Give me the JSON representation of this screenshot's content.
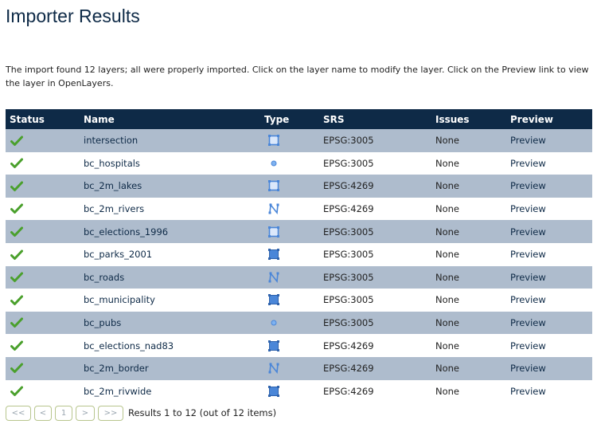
{
  "page": {
    "title": "Importer Results",
    "summary": "The import found 12 layers; all were properly imported. Click on the layer name to modify the layer. Click on the Preview link to view the layer in OpenLayers."
  },
  "table": {
    "headers": {
      "status": "Status",
      "name": "Name",
      "type": "Type",
      "srs": "SRS",
      "issues": "Issues",
      "preview": "Preview"
    },
    "rows": [
      {
        "status": "success-check-icon",
        "name": "intersection",
        "type": "polygon-outline-icon",
        "srs": "EPSG:3005",
        "issues": "None",
        "preview": "Preview"
      },
      {
        "status": "success-check-icon",
        "name": "bc_hospitals",
        "type": "point-icon",
        "srs": "EPSG:3005",
        "issues": "None",
        "preview": "Preview"
      },
      {
        "status": "success-check-icon",
        "name": "bc_2m_lakes",
        "type": "polygon-outline-icon",
        "srs": "EPSG:4269",
        "issues": "None",
        "preview": "Preview"
      },
      {
        "status": "success-check-icon",
        "name": "bc_2m_rivers",
        "type": "line-icon",
        "srs": "EPSG:4269",
        "issues": "None",
        "preview": "Preview"
      },
      {
        "status": "success-check-icon",
        "name": "bc_elections_1996",
        "type": "polygon-outline-icon",
        "srs": "EPSG:3005",
        "issues": "None",
        "preview": "Preview"
      },
      {
        "status": "success-check-icon",
        "name": "bc_parks_2001",
        "type": "polygon-icon",
        "srs": "EPSG:3005",
        "issues": "None",
        "preview": "Preview"
      },
      {
        "status": "success-check-icon",
        "name": "bc_roads",
        "type": "line-icon",
        "srs": "EPSG:3005",
        "issues": "None",
        "preview": "Preview"
      },
      {
        "status": "success-check-icon",
        "name": "bc_municipality",
        "type": "polygon-icon",
        "srs": "EPSG:3005",
        "issues": "None",
        "preview": "Preview"
      },
      {
        "status": "success-check-icon",
        "name": "bc_pubs",
        "type": "point-icon",
        "srs": "EPSG:3005",
        "issues": "None",
        "preview": "Preview"
      },
      {
        "status": "success-check-icon",
        "name": "bc_elections_nad83",
        "type": "polygon-icon",
        "srs": "EPSG:4269",
        "issues": "None",
        "preview": "Preview"
      },
      {
        "status": "success-check-icon",
        "name": "bc_2m_border",
        "type": "line-icon",
        "srs": "EPSG:4269",
        "issues": "None",
        "preview": "Preview"
      },
      {
        "status": "success-check-icon",
        "name": "bc_2m_rivwide",
        "type": "polygon-icon",
        "srs": "EPSG:4269",
        "issues": "None",
        "preview": "Preview"
      }
    ]
  },
  "pager": {
    "first_label": "<<",
    "prev_label": "<",
    "page_label": "1",
    "next_label": ">",
    "last_label": ">>",
    "status": "Results 1 to 12 (out of 12 items)"
  },
  "colors": {
    "header_bg": "#0e2a47",
    "odd_row_bg": "#aebccd",
    "even_row_bg": "#ffffff",
    "check_green": "#4aa02c",
    "icon_blue": "#4a86d8"
  }
}
